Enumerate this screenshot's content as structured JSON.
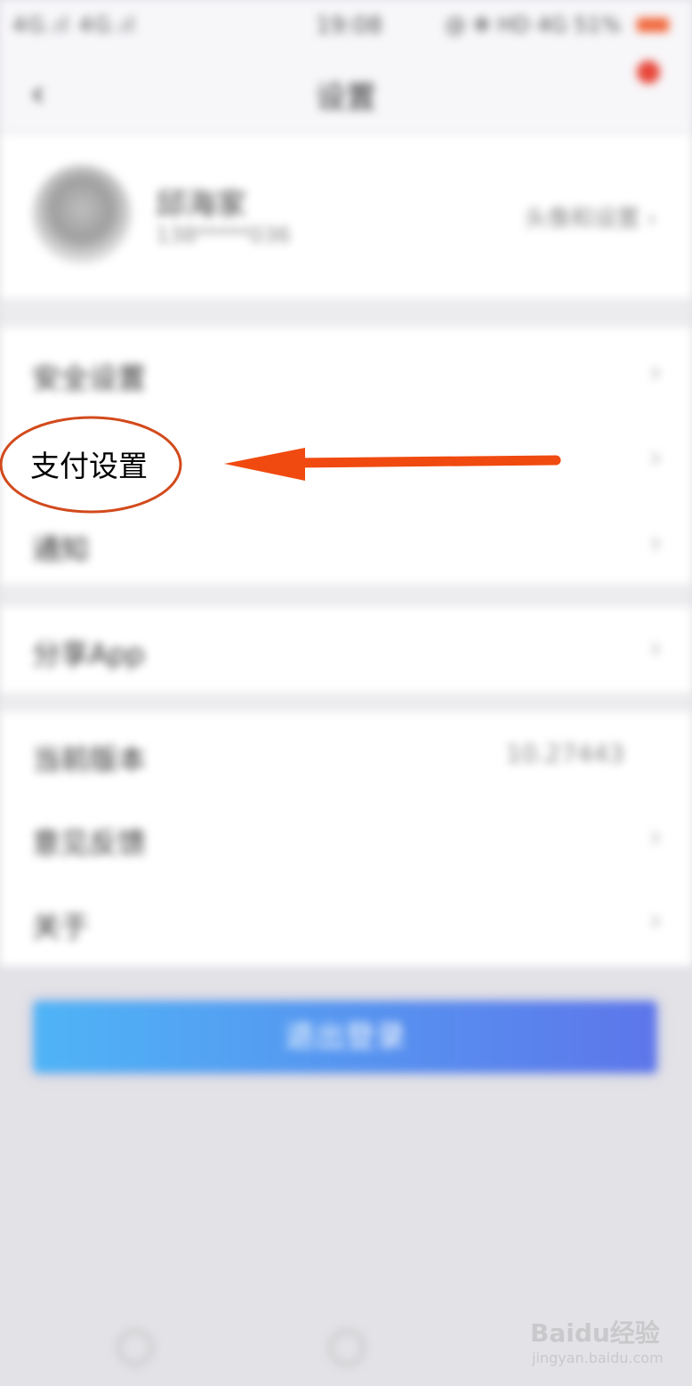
{
  "status_bar": {
    "signal": "4G.ıl 4G.ıl",
    "time": "19:08",
    "right": "@ ✻ HD 4G 51%"
  },
  "nav": {
    "title": "设置",
    "back_glyph": "‹"
  },
  "profile": {
    "name": "邱海家",
    "phone": "138*****036",
    "right_text": "头像和设置"
  },
  "menu_group1": [
    {
      "label": "安全设置",
      "chev": "›"
    },
    {
      "label": "支付设置",
      "chev": "›"
    },
    {
      "label": "通知",
      "chev": "›"
    }
  ],
  "menu_group2": [
    {
      "label": "分享App",
      "chev": "›"
    }
  ],
  "menu_group3": [
    {
      "label": "当前版本",
      "value": "10.27443",
      "chev": ""
    },
    {
      "label": "意见反馈",
      "value": "",
      "chev": "›"
    },
    {
      "label": "关于",
      "value": "",
      "chev": "›"
    }
  ],
  "logout_button": {
    "label": "退出登录"
  },
  "annotation": {
    "highlight_label": "支付设置",
    "color": "#f04a10"
  },
  "watermark": {
    "logo": "Baidu经验",
    "url": "jingyan.baidu.com"
  },
  "colors": {
    "accent_start": "#4fb4f6",
    "accent_end": "#5d76ea",
    "annotation": "#f04a10"
  }
}
